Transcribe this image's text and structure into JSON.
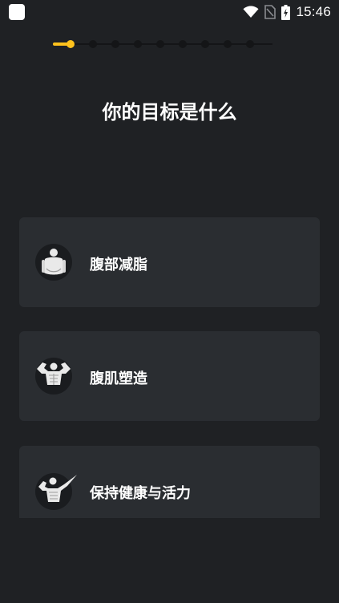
{
  "status_bar": {
    "time": "15:46",
    "icons": [
      "app-notification-icon",
      "wifi-icon",
      "no-sim-icon",
      "battery-charging-icon"
    ]
  },
  "progress": {
    "current_step": 1,
    "total_steps": 10
  },
  "title": "你的目标是什么",
  "options": [
    {
      "label": "腹部减脂",
      "icon": "belly-figure-icon"
    },
    {
      "label": "腹肌塑造",
      "icon": "muscle-pose-icon"
    },
    {
      "label": "保持健康与活力",
      "icon": "flexing-figure-icon"
    }
  ],
  "colors": {
    "background": "#1f2124",
    "card": "#2a2d31",
    "accent": "#ffc21d"
  }
}
